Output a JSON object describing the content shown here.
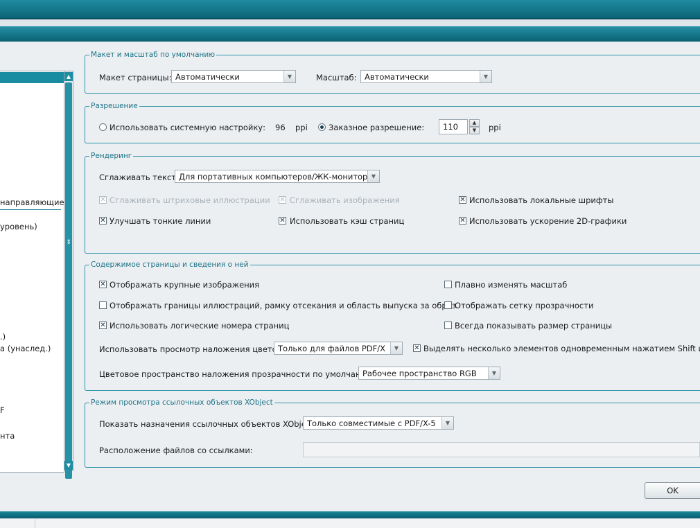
{
  "left_list": {
    "items": [
      "направляющие",
      "уровень)",
      ".)",
      "а (унаслед.)",
      "F",
      "нта"
    ]
  },
  "layout": {
    "legend": "Макет и масштаб по умолчанию",
    "page_layout_label": "Макет страницы:",
    "page_layout_value": "Автоматически",
    "zoom_label": "Масштаб:",
    "zoom_value": "Автоматически"
  },
  "resolution": {
    "legend": "Разрешение",
    "system_label": "Использовать системную настройку:",
    "system_value": "96",
    "system_unit": "ppi",
    "custom_label": "Заказное разрешение:",
    "custom_value": "110",
    "custom_unit": "ppi",
    "selected": "custom"
  },
  "rendering": {
    "legend": "Рендеринг",
    "smooth_text_label": "Сглаживать текст:",
    "smooth_text_value": "Для портативных компьютеров/ЖК-мониторов",
    "smooth_line_art": "Сглаживать штриховые иллюстрации",
    "smooth_images": "Сглаживать изображения",
    "local_fonts": "Использовать локальные шрифты",
    "thin_lines": "Улучшать тонкие линии",
    "page_cache": "Использовать кэш страниц",
    "accel_2d": "Использовать ускорение 2D-графики"
  },
  "page_content": {
    "legend": "Содержимое страницы и сведения о ней",
    "large_images": "Отображать крупные изображения",
    "smooth_zoom": "Плавно изменять масштаб",
    "art_bleed": "Отображать границы иллюстраций, рамку отсекания и область выпуска за обрез",
    "transparency_grid": "Отображать сетку прозрачности",
    "logical_numbers": "Использовать логические номера страниц",
    "page_size": "Всегда показывать размер страницы",
    "overprint_label": "Использовать просмотр наложения цветов:",
    "overprint_value": "Только для файлов PDF/X",
    "shift_select": "Выделять несколько элементов одновременным нажатием Shift и щелчк",
    "blend_space_label": "Цветовое пространство наложения прозрачности по умолчанию:",
    "blend_space_value": "Рабочее пространство RGB"
  },
  "xobject": {
    "legend": "Режим просмотра ссылочных объектов XObject",
    "show_targets_label": "Показать назначения ссылочных объектов XObject:",
    "show_targets_value": "Только совместимые с PDF/X-5",
    "files_location_label": "Расположение файлов со ссылками:",
    "files_location_value": ""
  },
  "ok_label": "OK"
}
